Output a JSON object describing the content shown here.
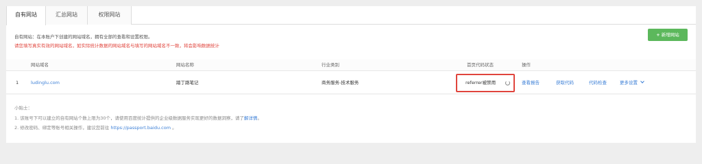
{
  "tabs": [
    {
      "label": "自有网站"
    },
    {
      "label": "汇总网站"
    },
    {
      "label": "权限网站"
    }
  ],
  "info": {
    "line1": "自有网站：在本账户下创建的网站域名，拥有全部的查看和设置权限。",
    "line2": "请您填写真实有效的网站域名，如实际统计数据的网站域名与填写的网站域名不一致，将会影响数据统计"
  },
  "new_site_button": {
    "icon": "+",
    "label": "新增网站"
  },
  "table": {
    "headers": {
      "domain": "网站域名",
      "name": "网站名称",
      "category": "行业类别",
      "code_status": "首页代码状态",
      "actions": "操作"
    },
    "rows": [
      {
        "index": "1",
        "domain": "ludinglu.com",
        "name": "踏丁路笔记",
        "category": "商务服务-技术服务",
        "code_status": "referrer被禁用",
        "actions": {
          "view_report": "查看报告",
          "get_code": "获取代码",
          "check_code": "代码检查",
          "more_settings": "更多设置"
        }
      }
    ]
  },
  "tips": {
    "title": "小贴士：",
    "tip1_text": "1. 该账号下可以建立的自有网站个数上限为30个，请使用百度统计提供的企业级数据服务实现更好的数据洞察，请了",
    "tip1_link": "解详情",
    "tip1_end": "。",
    "tip2_text": "2. 修改密码、绑定等账号相关操作，建议您前往 ",
    "tip2_url": "https://passport.baidu.com",
    "tip2_end": " 。"
  },
  "colors": {
    "accent_link": "#3a7ed6",
    "success_button": "#5cb85c",
    "warning_text": "#e0443c",
    "highlight_box": "#e0443c"
  }
}
